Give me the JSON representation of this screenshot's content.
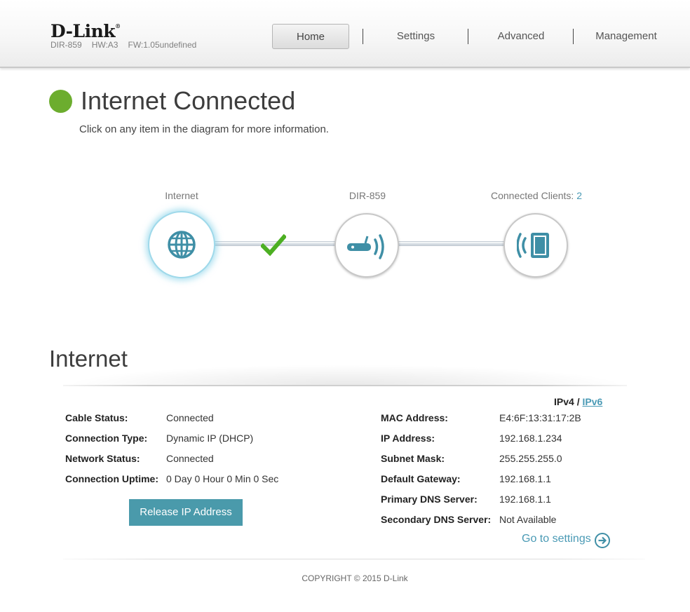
{
  "header": {
    "logo": "D-Link",
    "logo_mark": "®",
    "model": "DIR-859",
    "hw": "HW:A3",
    "fw": "FW:1.05undefined",
    "nav": [
      "Home",
      "Settings",
      "Advanced",
      "Management"
    ]
  },
  "status": {
    "title": "Internet Connected",
    "hint": "Click on any item in the diagram for more information.",
    "color": "#6cad2e"
  },
  "diagram": {
    "internet_label": "Internet",
    "router_label": "DIR-859",
    "clients_label": "Connected Clients: ",
    "clients_count": "2",
    "icons": [
      "globe-icon",
      "checkmark-icon",
      "router-icon",
      "device-icon"
    ]
  },
  "internet": {
    "title": "Internet",
    "ipv4": "IPv4",
    "separator": "/",
    "ipv6": "IPv6",
    "left": [
      {
        "label": "Cable Status:",
        "value": "Connected"
      },
      {
        "label": "Connection Type:",
        "value": "Dynamic IP (DHCP)"
      },
      {
        "label": "Network Status:",
        "value": "Connected"
      },
      {
        "label": "Connection Uptime:",
        "value": "0 Day 0 Hour 0 Min 0 Sec"
      }
    ],
    "right": [
      {
        "label": "MAC Address:",
        "value": "E4:6F:13:31:17:2B"
      },
      {
        "label": "IP Address:",
        "value": "192.168.1.234"
      },
      {
        "label": "Subnet Mask:",
        "value": "255.255.255.0"
      },
      {
        "label": "Default Gateway:",
        "value": "192.168.1.1"
      },
      {
        "label": "Primary DNS Server:",
        "value": "192.168.1.1"
      },
      {
        "label": "Secondary DNS Server:",
        "value": "Not Available"
      }
    ],
    "release_button": "Release IP Address",
    "goto_settings": "Go to settings"
  },
  "footer": {
    "copyright": "COPYRIGHT © 2015 D-Link"
  },
  "colors": {
    "accent": "#4a9ab5",
    "button": "#4a9aab",
    "check": "#4caf22"
  }
}
